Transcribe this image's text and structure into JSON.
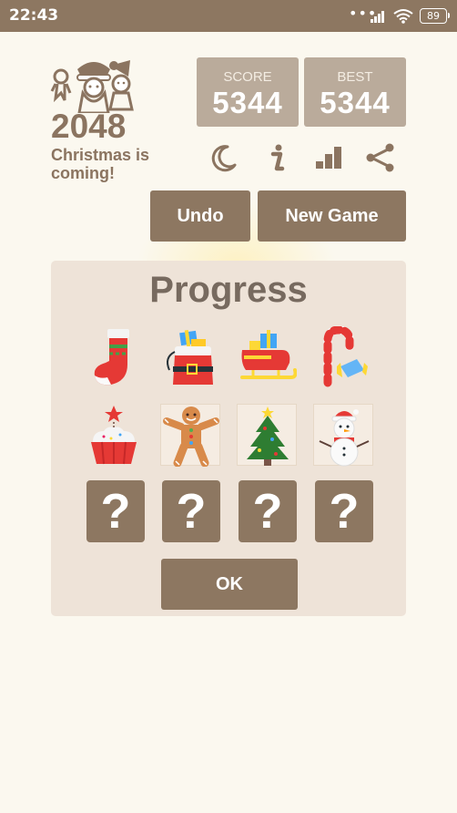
{
  "status_bar": {
    "time": "22:43",
    "more_indicator": "•••",
    "battery": "89"
  },
  "logo": {
    "title": "2048",
    "subtitle": "Christmas is coming!"
  },
  "score": {
    "label": "SCORE",
    "value": "5344"
  },
  "best": {
    "label": "BEST",
    "value": "5344"
  },
  "toolbar": {
    "icons": [
      "moon-icon",
      "info-icon",
      "leaderboard-icon",
      "share-icon"
    ]
  },
  "buttons": {
    "undo": "Undo",
    "new_game": "New Game",
    "ok": "OK"
  },
  "progress": {
    "title": "Progress",
    "items": [
      {
        "name": "stocking",
        "unlocked": true
      },
      {
        "name": "santa-bag",
        "unlocked": true
      },
      {
        "name": "sleigh",
        "unlocked": true
      },
      {
        "name": "candy-cane",
        "unlocked": true
      },
      {
        "name": "cupcake",
        "unlocked": true
      },
      {
        "name": "gingerbread-man",
        "unlocked": true
      },
      {
        "name": "christmas-tree",
        "unlocked": true
      },
      {
        "name": "snowman",
        "unlocked": true
      },
      {
        "name": "locked",
        "label": "?",
        "unlocked": false
      },
      {
        "name": "locked",
        "label": "?",
        "unlocked": false
      },
      {
        "name": "locked",
        "label": "?",
        "unlocked": false
      },
      {
        "name": "locked",
        "label": "?",
        "unlocked": false
      }
    ]
  },
  "colors": {
    "background": "#fbf8ef",
    "brown": "#8d7761",
    "score_box": "#baab9b",
    "panel": "#eee3d8"
  }
}
